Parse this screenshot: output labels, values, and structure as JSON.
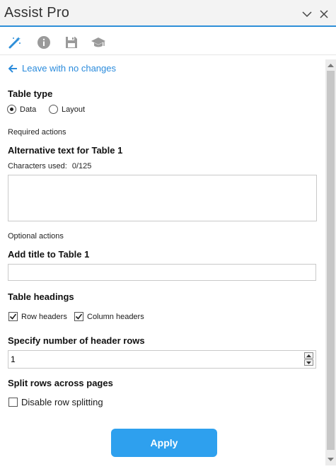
{
  "window": {
    "title": "Assist Pro"
  },
  "toolbar": {
    "tools": [
      "magic-wand-icon",
      "info-icon",
      "save-icon",
      "graduation-cap-icon"
    ]
  },
  "nav": {
    "back_label": "Leave with no changes"
  },
  "table_type": {
    "heading": "Table type",
    "options": [
      "Data",
      "Layout"
    ],
    "selected": "Data"
  },
  "required": {
    "section_label": "Required actions",
    "alt_text_heading": "Alternative text for Table 1",
    "chars_used_label": "Characters used:",
    "chars_used_value": "0/125",
    "alt_text_value": ""
  },
  "optional": {
    "section_label": "Optional actions",
    "title_heading": "Add title to Table 1",
    "title_value": ""
  },
  "headings": {
    "heading": "Table headings",
    "row_headers_label": "Row headers",
    "row_headers_checked": true,
    "column_headers_label": "Column headers",
    "column_headers_checked": true
  },
  "header_rows": {
    "heading": "Specify number of header rows",
    "value": "1"
  },
  "split": {
    "heading": "Split rows across pages",
    "disable_label": "Disable row splitting",
    "disable_checked": false
  },
  "actions": {
    "apply_label": "Apply"
  },
  "colors": {
    "accent": "#2e8fd8",
    "apply_bg": "#2ea0ee",
    "link": "#2a8bdc"
  }
}
